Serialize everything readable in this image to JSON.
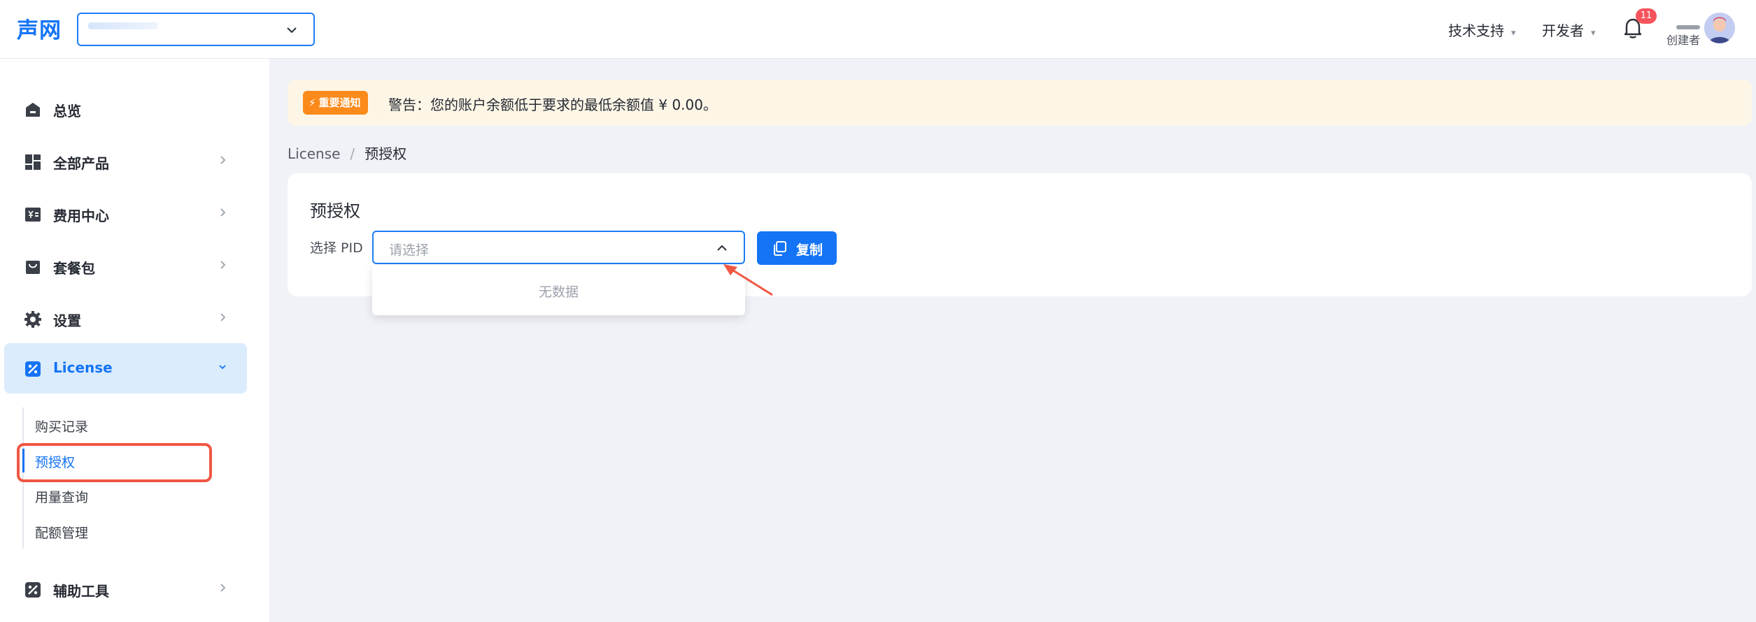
{
  "header": {
    "logo": "声网",
    "support_label": "技术支持",
    "developer_label": "开发者",
    "notification_count": "11",
    "user_role": "创建者"
  },
  "sidebar": {
    "items": [
      {
        "label": "总览",
        "icon": "home-icon"
      },
      {
        "label": "全部产品",
        "icon": "grid-icon"
      },
      {
        "label": "费用中心",
        "icon": "billing-icon"
      },
      {
        "label": "套餐包",
        "icon": "bag-icon"
      },
      {
        "label": "设置",
        "icon": "gear-icon"
      },
      {
        "label": "License",
        "icon": "license-icon"
      },
      {
        "label": "辅助工具",
        "icon": "tool-icon"
      }
    ],
    "license_sub": [
      {
        "label": "购买记录"
      },
      {
        "label": "预授权"
      },
      {
        "label": "用量查询"
      },
      {
        "label": "配额管理"
      }
    ]
  },
  "notice": {
    "tag": "重要通知",
    "text": "警告：您的账户余额低于要求的最低余额值 ¥ 0.00。"
  },
  "breadcrumb": {
    "parent": "License",
    "separator": "/",
    "current": "预授权"
  },
  "card": {
    "title": "预授权",
    "pid_label": "选择 PID",
    "pid_placeholder": "请选择",
    "copy_label": "复制",
    "dropdown_empty": "无数据"
  },
  "colors": {
    "primary": "#1474f5",
    "notice_tag": "#fb8a1a",
    "annotation_red": "#ef5743",
    "badge": "#f5545d"
  }
}
